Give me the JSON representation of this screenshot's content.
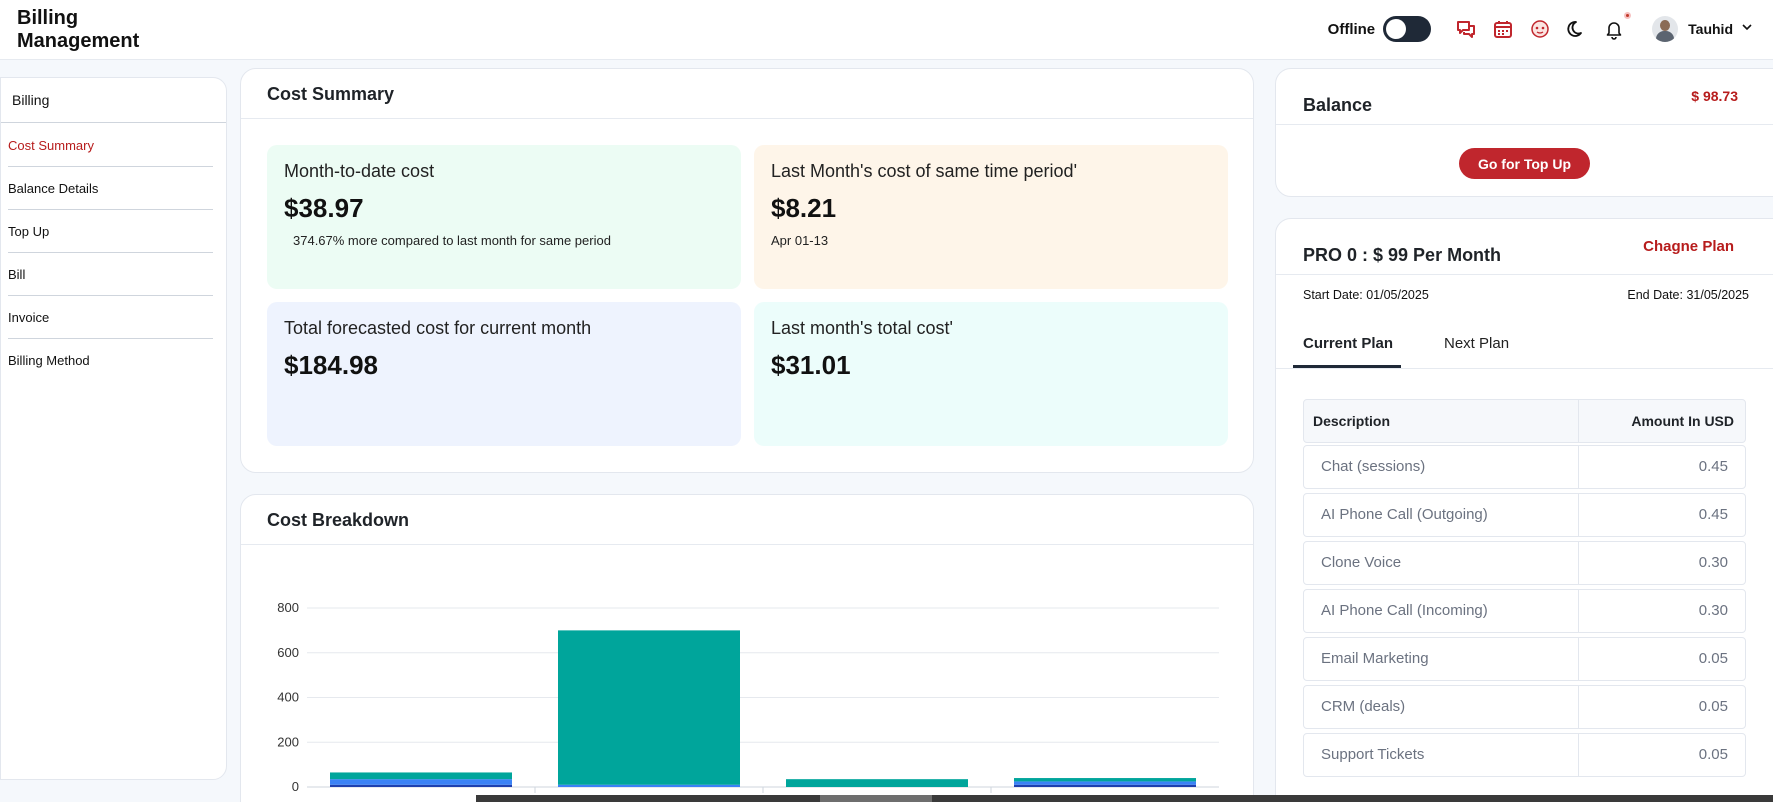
{
  "header": {
    "brand_line1": "Billing",
    "brand_line2": "Management",
    "offline_label": "Offline",
    "user_name": "Tauhid",
    "icons": [
      "chat-icon",
      "calendar-icon",
      "ai-face-icon",
      "moon-icon",
      "bell-icon",
      "avatar",
      "chevron-down-icon"
    ]
  },
  "sidebar": {
    "title": "Billing",
    "items": [
      {
        "label": "Cost Summary",
        "active": true
      },
      {
        "label": "Balance Details"
      },
      {
        "label": "Top Up"
      },
      {
        "label": "Bill"
      },
      {
        "label": "Invoice"
      },
      {
        "label": "Billing Method"
      }
    ]
  },
  "cost_summary": {
    "title": "Cost Summary",
    "tiles": [
      {
        "label": "Month-to-date cost",
        "value": "$38.97",
        "sub": "374.67% more compared to last month for same period"
      },
      {
        "label": "Last Month's cost of same time period'",
        "value": "$8.21",
        "sub": "Apr 01-13"
      },
      {
        "label": "Total forecasted cost for current month",
        "value": "$184.98"
      },
      {
        "label": "Last month's total cost'",
        "value": "$31.01"
      }
    ]
  },
  "cost_breakdown": {
    "title": "Cost Breakdown"
  },
  "chart_data": {
    "type": "bar",
    "stacked": true,
    "categories": [
      "",
      "",
      "",
      ""
    ],
    "series": [
      {
        "values": [
          10,
          0,
          0,
          10
        ],
        "color": "#1e40af"
      },
      {
        "values": [
          25,
          10,
          0,
          15
        ],
        "color": "#3b82f6"
      },
      {
        "values": [
          30,
          690,
          35,
          15
        ],
        "color": "#00a59b"
      }
    ],
    "y_ticks": [
      "0",
      "200",
      "400",
      "600",
      "800"
    ],
    "ylim": [
      0,
      800
    ],
    "grid": true
  },
  "balance": {
    "title": "Balance",
    "amount": "$ 98.73",
    "topup_label": "Go for Top Up"
  },
  "plan": {
    "name": "PRO 0 : $ 99 Per Month",
    "change_label": "Chagne Plan",
    "start_date": "Start Date: 01/05/2025",
    "end_date": "End Date: 31/05/2025",
    "tabs": [
      "Current Plan",
      "Next Plan"
    ],
    "table_headers": [
      "Description",
      "Amount In USD"
    ],
    "rows": [
      {
        "desc": "Chat (sessions)",
        "amount": "0.45"
      },
      {
        "desc": "AI Phone Call (Outgoing)",
        "amount": "0.45"
      },
      {
        "desc": "Clone Voice",
        "amount": "0.30"
      },
      {
        "desc": "AI Phone Call (Incoming)",
        "amount": "0.30"
      },
      {
        "desc": "Email Marketing",
        "amount": "0.05"
      },
      {
        "desc": "CRM (deals)",
        "amount": "0.05"
      },
      {
        "desc": "Support Tickets",
        "amount": "0.05"
      }
    ]
  },
  "colors": {
    "accent": "#b71c1c",
    "button": "#c0262d",
    "bar_teal": "#00a59b",
    "bar_blue": "#3b82f6"
  }
}
